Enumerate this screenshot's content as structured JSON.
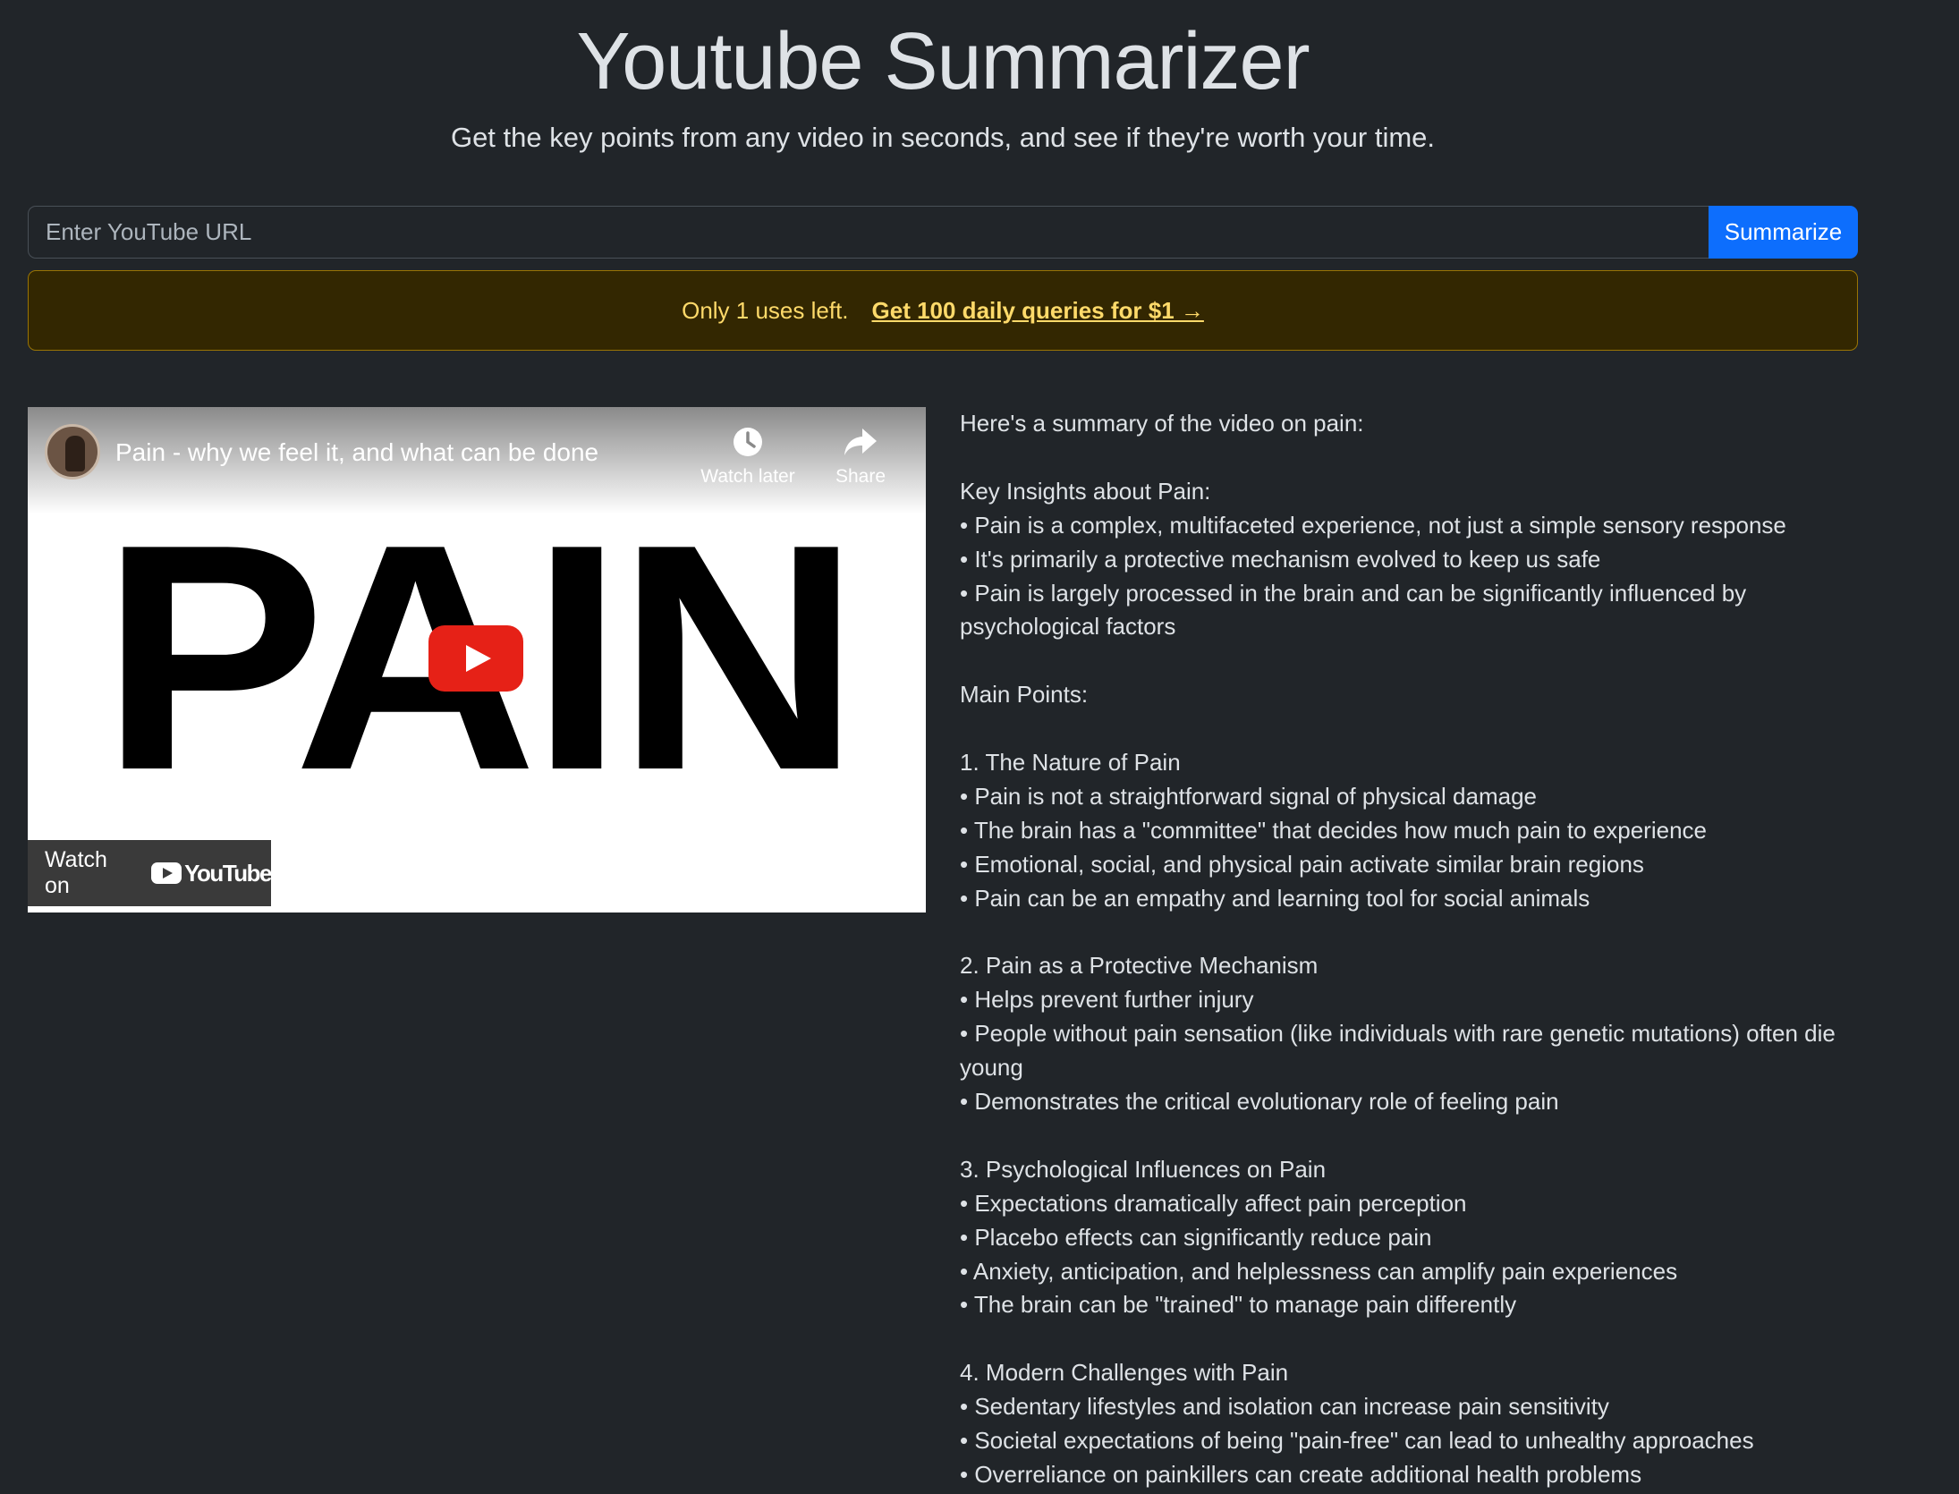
{
  "header": {
    "title": "Youtube Summarizer",
    "subtitle": "Get the key points from any video in seconds, and see if they're worth your time."
  },
  "search": {
    "placeholder": "Enter YouTube URL",
    "value": "",
    "button_label": "Summarize"
  },
  "alert": {
    "text": "Only 1 uses left.",
    "link_label": "Get 100 daily queries for $1 →"
  },
  "video": {
    "title": "Pain - why we feel it, and what can be done",
    "thumbnail_text": "PAIN",
    "watch_later_label": "Watch later",
    "share_label": "Share",
    "watch_on_label": "Watch on",
    "youtube_word": "YouTube",
    "icons": [
      "clock-icon",
      "share-arrow-icon",
      "play-icon",
      "youtube-logo-icon"
    ]
  },
  "summary": {
    "intro": "Here's a summary of the video on pain:",
    "key_insights_heading": "Key Insights about Pain:",
    "key_insights": [
      "• Pain is a complex, multifaceted experience, not just a simple sensory response",
      "• It's primarily a protective mechanism evolved to keep us safe",
      "• Pain is largely processed in the brain and can be significantly influenced by",
      "psychological factors"
    ],
    "main_points_heading": "Main Points:",
    "sections": [
      {
        "heading": "1. The Nature of Pain",
        "lines": [
          "• Pain is not a straightforward signal of physical damage",
          "• The brain has a \"committee\" that decides how much pain to experience",
          "• Emotional, social, and physical pain activate similar brain regions",
          "• Pain can be an empathy and learning tool for social animals"
        ]
      },
      {
        "heading": "2. Pain as a Protective Mechanism",
        "lines": [
          "• Helps prevent further injury",
          "• People without pain sensation (like individuals with rare genetic mutations) often die",
          "young",
          "• Demonstrates the critical evolutionary role of feeling pain"
        ]
      },
      {
        "heading": "3. Psychological Influences on Pain",
        "lines": [
          "• Expectations dramatically affect pain perception",
          "• Placebo effects can significantly reduce pain",
          "• Anxiety, anticipation, and helplessness can amplify pain experiences",
          "• The brain can be \"trained\" to manage pain differently"
        ]
      },
      {
        "heading": "4. Modern Challenges with Pain",
        "lines": [
          "• Sedentary lifestyles and isolation can increase pain sensitivity",
          "• Societal expectations of being \"pain-free\" can lead to unhealthy approaches",
          "• Overreliance on painkillers can create additional health problems"
        ]
      }
    ]
  },
  "colors": {
    "background": "#212529",
    "primary": "#0d6efd",
    "alert_bg": "#332701",
    "alert_text": "#ffda6a",
    "youtube_red": "#e62117"
  }
}
